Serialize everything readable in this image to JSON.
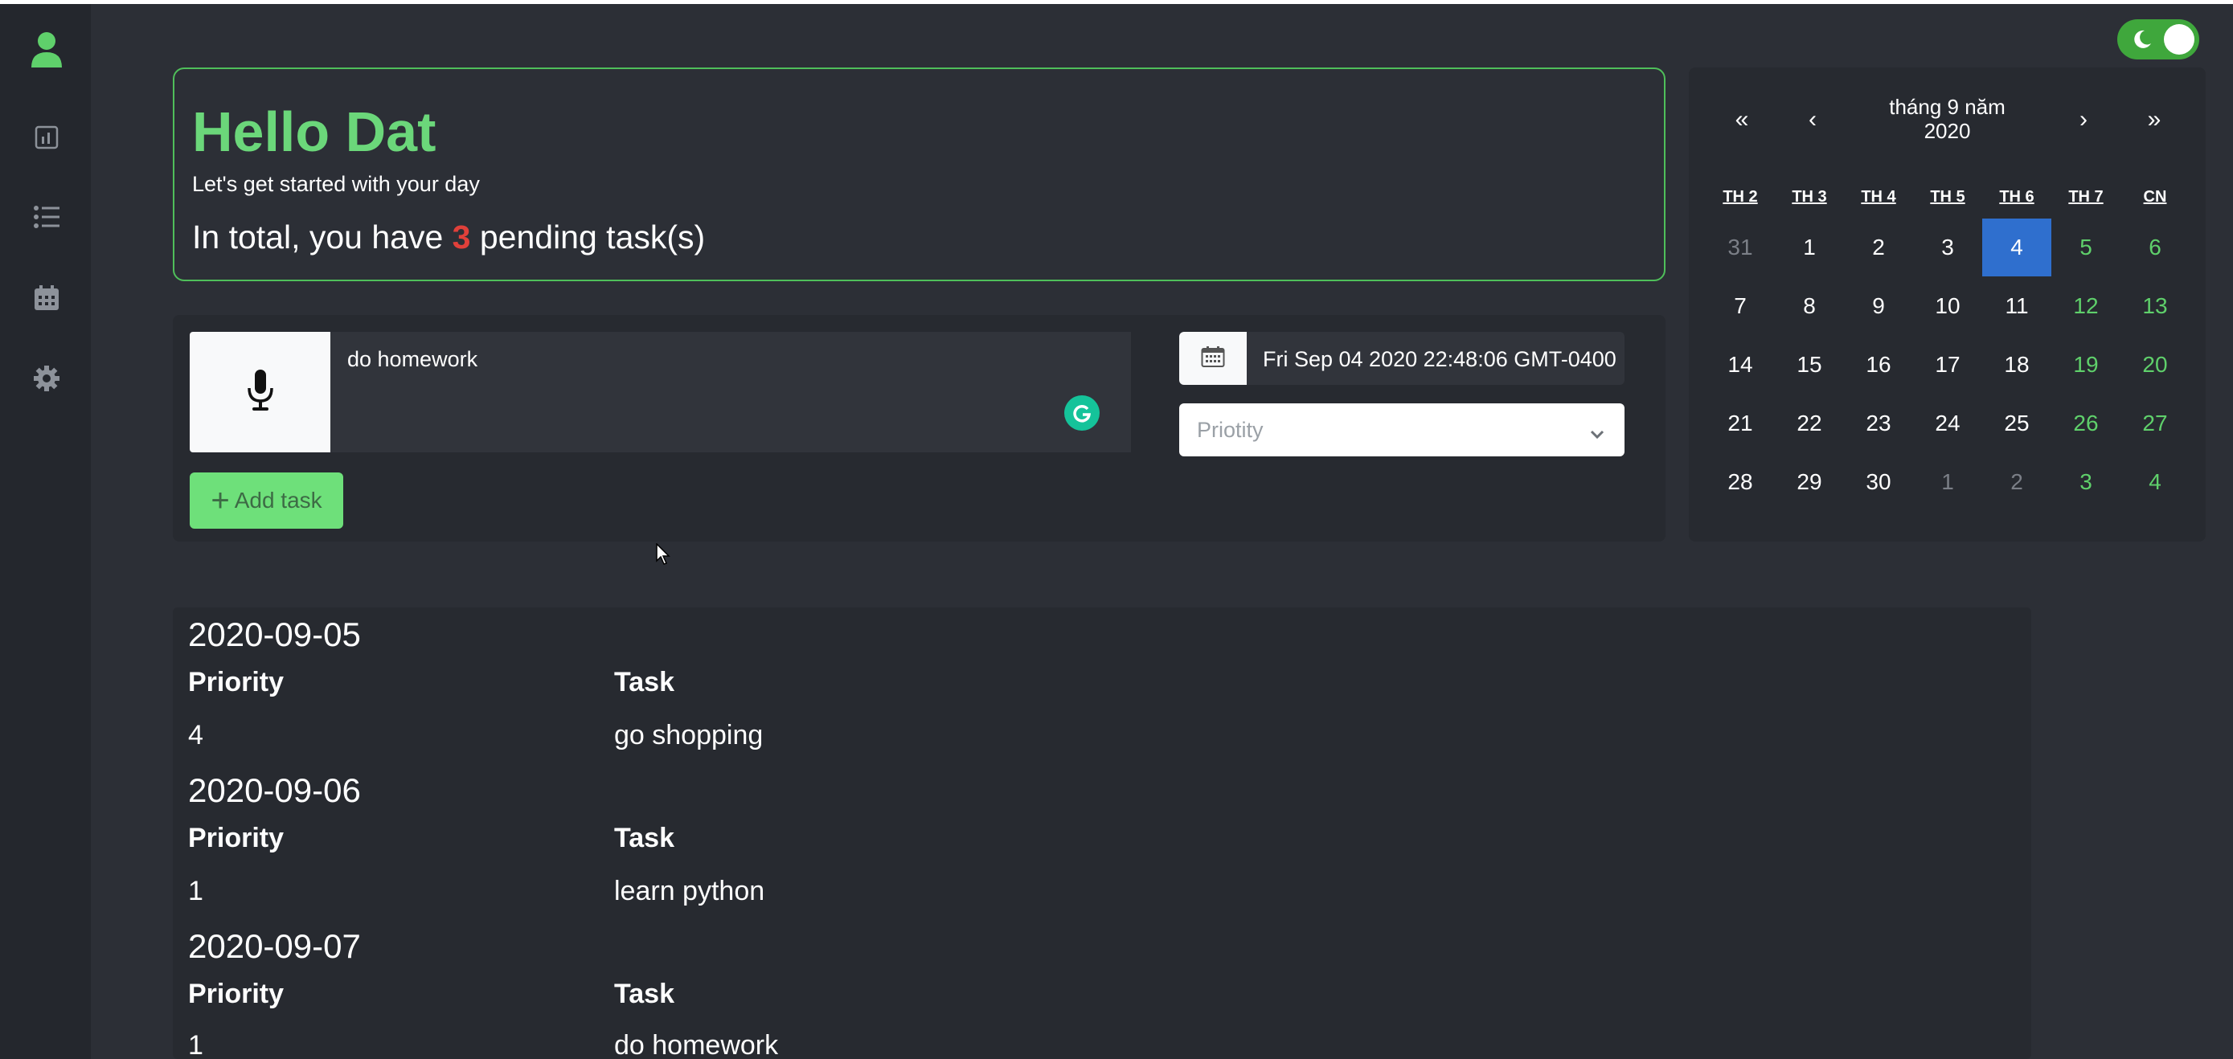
{
  "theme": {
    "accent": "#6bd77a",
    "toggle": "#3fa73c",
    "selected_day": "#2f6fce",
    "danger": "#e0403a"
  },
  "sidebar": {
    "items": [
      {
        "icon": "user-icon"
      },
      {
        "icon": "chart-icon"
      },
      {
        "icon": "list-icon"
      },
      {
        "icon": "calendar-icon"
      },
      {
        "icon": "gear-icon"
      }
    ]
  },
  "header": {
    "toggle_state": "on",
    "toggle_icon": "moon-icon"
  },
  "greeting": {
    "title": "Hello Dat",
    "subtitle": "Let's get started with your day",
    "total_prefix": "In total, you have ",
    "pending_count": "3",
    "total_suffix": " pending task(s)"
  },
  "add_task": {
    "task_value": "do homework",
    "add_button_label": "Add task",
    "date_value": "Fri Sep 04 2020 22:48:06 GMT-0400",
    "priority_placeholder": "Priotity"
  },
  "calendar": {
    "prev2": "«",
    "prev": "‹",
    "next": "›",
    "next2": "»",
    "month_title_line1": "tháng 9 năm",
    "month_title_line2": "2020",
    "weekdays": [
      "TH 2",
      "TH 3",
      "TH 4",
      "TH 5",
      "TH 6",
      "TH 7",
      "CN"
    ],
    "weeks": [
      [
        "31",
        "1",
        "2",
        "3",
        "4",
        "5",
        "6"
      ],
      [
        "7",
        "8",
        "9",
        "10",
        "11",
        "12",
        "13"
      ],
      [
        "14",
        "15",
        "16",
        "17",
        "18",
        "19",
        "20"
      ],
      [
        "21",
        "22",
        "23",
        "24",
        "25",
        "26",
        "27"
      ],
      [
        "28",
        "29",
        "30",
        "1",
        "2",
        "3",
        "4"
      ]
    ],
    "selected": "4"
  },
  "task_groups": [
    {
      "date": "2020-09-05",
      "priority_header": "Priority",
      "task_header": "Task",
      "priority": "4",
      "task": "go shopping"
    },
    {
      "date": "2020-09-06",
      "priority_header": "Priority",
      "task_header": "Task",
      "priority": "1",
      "task": "learn python"
    },
    {
      "date": "2020-09-07",
      "priority_header": "Priority",
      "task_header": "Task",
      "priority": "1",
      "task": "do homework"
    }
  ]
}
